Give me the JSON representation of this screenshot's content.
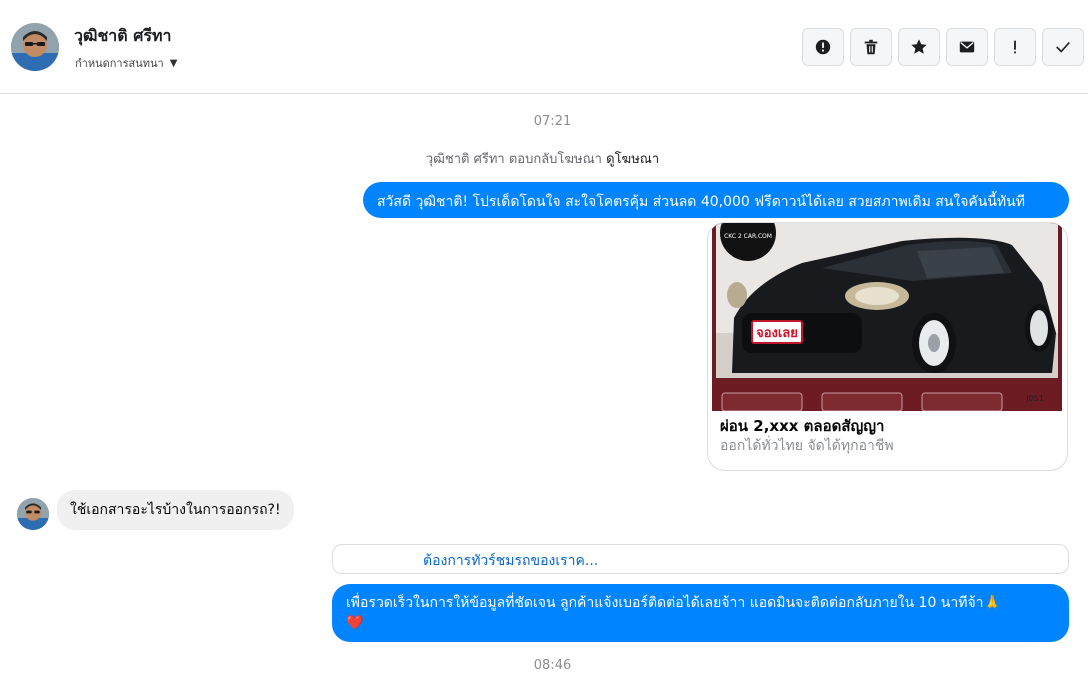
{
  "header": {
    "contact_name": "วุฒิชาติ ศรีทา",
    "subtitle": "กำหนดการสนทนา",
    "actions": [
      {
        "icon": "alert-circle-icon",
        "name": "spam-button"
      },
      {
        "icon": "trash-icon",
        "name": "delete-button"
      },
      {
        "icon": "star-icon",
        "name": "star-button"
      },
      {
        "icon": "envelope-icon",
        "name": "mark-unread-button"
      },
      {
        "icon": "exclamation-icon",
        "name": "priority-button"
      },
      {
        "icon": "checkmark-icon",
        "name": "done-button"
      }
    ]
  },
  "conversation": {
    "timestamp_1": "07:21",
    "reply_note": {
      "text": "วุฒิชาติ ศรีทา ตอบกลับโฆษณา",
      "link": "ดูโฆษณา"
    },
    "outgoing_1": "สวัสดี วุฒิชาติ! โปรเด็ดโดนใจ สะใจโคตรคุ้ม ส่วนลด 40,000 ฟรีดาวน์ได้เลย สวยสภาพเดิม สนใจคันนี้ทันที",
    "ad_card": {
      "title": "ผ่อน 2,xxx ตลอดสัญญา",
      "subtitle": "ออกได้ทั่วไทย จัดได้ทุกอาชีพ",
      "badge": "จองเลย",
      "code": "J051",
      "logo_text": "CKC 2 CAR.COM"
    },
    "incoming_1": "ใช้เอกสารอะไรบ้างในการออกรถ?!",
    "quick_reply": "ต้องการทัวร์ชมรถของเราค...",
    "outgoing_2": "เพื่อรวดเร็วในการให้ข้อมูลที่ชัดเจน ลูกค้าแจ้งเบอร์ติดต่อได้เลยจ้าา แอดมินจะติดต่อกลับภายใน 10 นาทีจ้า🙏",
    "outgoing_2_emoji": "❤️",
    "timestamp_2": "08:46"
  },
  "colors": {
    "accent": "#0084ff",
    "bubble_in": "#f0f0f0",
    "border": "#dadde1"
  }
}
